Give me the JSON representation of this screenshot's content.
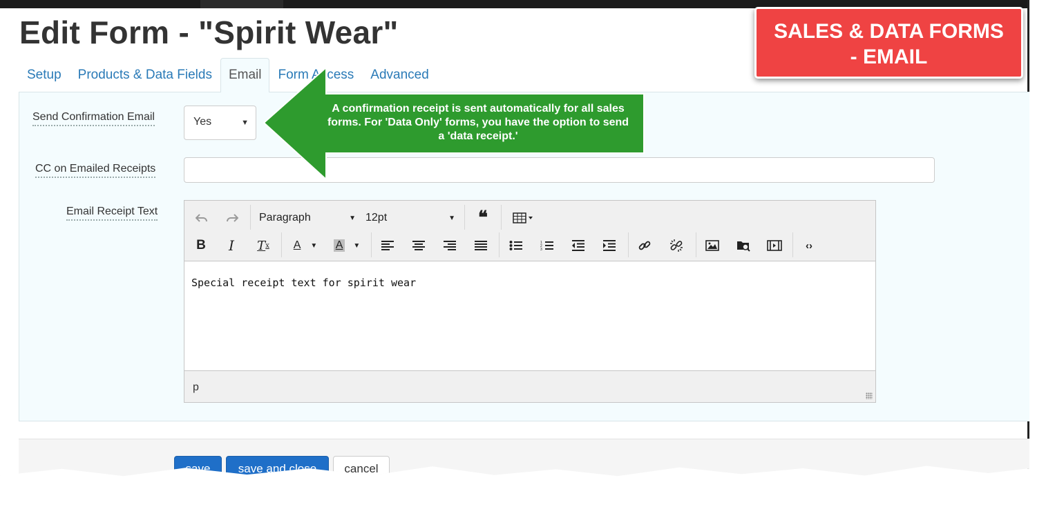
{
  "page": {
    "title": "Edit Form - \"Spirit Wear\""
  },
  "tabs": [
    {
      "label": "Setup"
    },
    {
      "label": "Products & Data Fields"
    },
    {
      "label": "Email"
    },
    {
      "label": "Form Access"
    },
    {
      "label": "Advanced"
    }
  ],
  "active_tab": "Email",
  "form": {
    "send_confirmation_label": "Send Confirmation Email",
    "send_confirmation_value": "Yes",
    "cc_label": "CC on Emailed Receipts",
    "cc_value": "",
    "receipt_text_label": "Email Receipt Text"
  },
  "editor": {
    "block_format": "Paragraph",
    "font_size": "12pt",
    "content": "Special receipt text for spirit wear",
    "status_path": "p",
    "toolbar_icons": [
      "undo-icon",
      "redo-icon",
      "blockquote-icon",
      "table-icon",
      "bold-icon",
      "italic-icon",
      "clear-formatting-icon",
      "text-color-icon",
      "background-color-icon",
      "align-left-icon",
      "align-center-icon",
      "align-right-icon",
      "justify-icon",
      "bullet-list-icon",
      "numbered-list-icon",
      "outdent-icon",
      "indent-icon",
      "link-icon",
      "unlink-icon",
      "image-icon",
      "file-browser-icon",
      "media-icon",
      "source-code-icon"
    ]
  },
  "footer": {
    "save": "save",
    "save_close": "save and close",
    "cancel": "cancel"
  },
  "annotation": {
    "badge_line1": "SALES & DATA FORMS",
    "badge_line2": "- EMAIL",
    "callout_text": "A confirmation receipt is sent automatically for all sales forms. For 'Data Only' forms, you have the option to send a 'data receipt.'"
  },
  "colors": {
    "link": "#2a7ab7",
    "panel_bg": "#f4fcfe",
    "primary_button": "#1f6fc8",
    "badge": "#ef4343",
    "callout": "#2e9b2e"
  }
}
